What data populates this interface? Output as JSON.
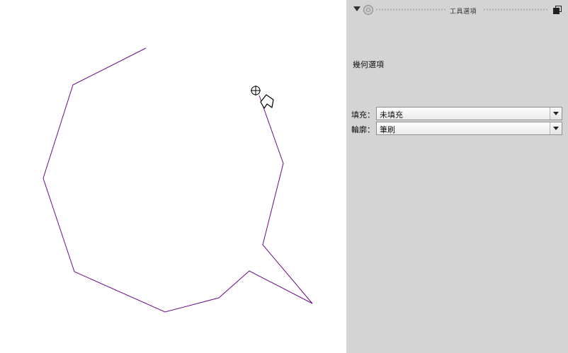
{
  "colors": {
    "stroke": "#6a0a8c",
    "dock_background": "#d4d4d4",
    "canvas_background": "#ffffff"
  },
  "dock": {
    "title": "工具選項",
    "icons": [
      "collapse-arrow-icon",
      "tool-round-icon",
      "float-window-icon"
    ]
  },
  "tool_options": {
    "section_title": "幾何選項",
    "fill": {
      "label": "填充：",
      "value": "未填充"
    },
    "outline": {
      "label": "輪廓：",
      "value": "筆刷"
    }
  },
  "canvas": {
    "shape": "open polyline (polygon being drawn)",
    "cursor": "crosshair-with-polygon-tool-icon"
  }
}
